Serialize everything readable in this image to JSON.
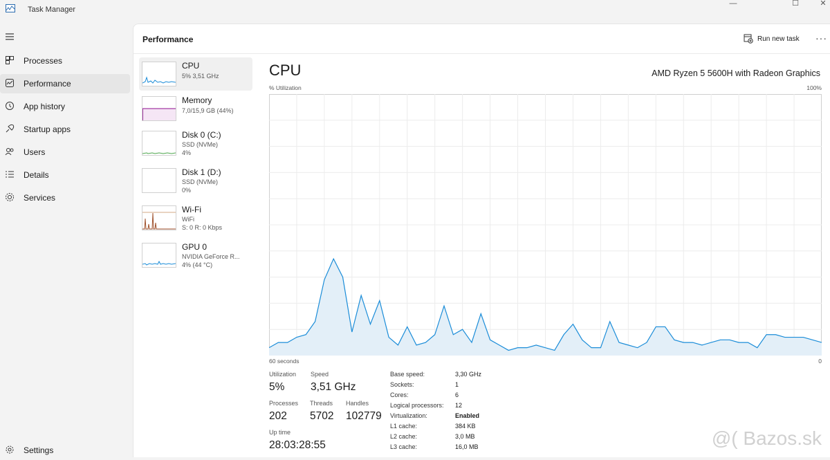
{
  "window": {
    "title": "Task Manager",
    "minimize": "—",
    "maximize": "☐",
    "close": "✕"
  },
  "nav": {
    "items": [
      {
        "label": "Processes",
        "icon": "processes-icon"
      },
      {
        "label": "Performance",
        "icon": "performance-icon",
        "active": true
      },
      {
        "label": "App history",
        "icon": "app-history-icon"
      },
      {
        "label": "Startup apps",
        "icon": "startup-apps-icon"
      },
      {
        "label": "Users",
        "icon": "users-icon"
      },
      {
        "label": "Details",
        "icon": "details-icon"
      },
      {
        "label": "Services",
        "icon": "services-icon"
      }
    ],
    "settings": "Settings"
  },
  "header": {
    "title": "Performance",
    "run_new_task": "Run new task",
    "more": "···"
  },
  "devices": [
    {
      "name": "CPU",
      "line1": "5%  3,51 GHz",
      "line2": ""
    },
    {
      "name": "Memory",
      "line1": "7,0/15,9 GB (44%)",
      "line2": ""
    },
    {
      "name": "Disk 0 (C:)",
      "line1": "SSD (NVMe)",
      "line2": "4%"
    },
    {
      "name": "Disk 1 (D:)",
      "line1": "SSD (NVMe)",
      "line2": "0%"
    },
    {
      "name": "Wi-Fi",
      "line1": "WiFi",
      "line2": "S: 0 R: 0 Kbps"
    },
    {
      "name": "GPU 0",
      "line1": "NVIDIA GeForce R...",
      "line2": "4% (44 °C)"
    }
  ],
  "detail": {
    "title": "CPU",
    "model": "AMD Ryzen 5 5600H with Radeon Graphics",
    "y_label": "% Utilization",
    "y_max_label": "100%",
    "x_start_label": "60 seconds",
    "x_end_label": "0"
  },
  "chart_data": {
    "type": "area",
    "title": "",
    "xlabel": "",
    "ylabel": "% Utilization",
    "xlim": [
      60,
      0
    ],
    "ylim": [
      0,
      100
    ],
    "grid": true,
    "color": "#1a8cd8",
    "fill": "#e3eff8",
    "x": [
      60,
      59,
      58,
      57,
      56,
      55,
      54,
      53,
      52,
      51,
      50,
      49,
      48,
      47,
      46,
      45,
      44,
      43,
      42,
      41,
      40,
      39,
      38,
      37,
      36,
      35,
      34,
      33,
      32,
      31,
      30,
      29,
      28,
      27,
      26,
      25,
      24,
      23,
      22,
      21,
      20,
      19,
      18,
      17,
      16,
      15,
      14,
      13,
      12,
      11,
      10,
      9,
      8,
      7,
      6,
      5,
      4,
      3,
      2,
      1,
      0
    ],
    "values": [
      3,
      5,
      5,
      7,
      8,
      13,
      29,
      37,
      30,
      9,
      23,
      12,
      21,
      7,
      4,
      11,
      4,
      5,
      8,
      19,
      8,
      10,
      5,
      16,
      6,
      4,
      2,
      3,
      3,
      4,
      3,
      2,
      8,
      12,
      6,
      3,
      3,
      13,
      5,
      4,
      3,
      5,
      11,
      11,
      6,
      5,
      5,
      4,
      5,
      6,
      6,
      5,
      5,
      3,
      8,
      8,
      7,
      7,
      7,
      6,
      5
    ]
  },
  "stats": {
    "utilization_label": "Utilization",
    "utilization": "5%",
    "speed_label": "Speed",
    "speed": "3,51 GHz",
    "processes_label": "Processes",
    "processes": "202",
    "threads_label": "Threads",
    "threads": "5702",
    "handles_label": "Handles",
    "handles": "102779",
    "uptime_label": "Up time",
    "uptime": "28:03:28:55"
  },
  "specs": [
    {
      "k": "Base speed:",
      "v": "3,30 GHz"
    },
    {
      "k": "Sockets:",
      "v": "1"
    },
    {
      "k": "Cores:",
      "v": "6"
    },
    {
      "k": "Logical processors:",
      "v": "12"
    },
    {
      "k": "Virtualization:",
      "v": "Enabled",
      "bold": true
    },
    {
      "k": "L1 cache:",
      "v": "384 KB"
    },
    {
      "k": "L2 cache:",
      "v": "3,0 MB"
    },
    {
      "k": "L3 cache:",
      "v": "16,0 MB"
    }
  ],
  "watermark": "@( Bazos.sk"
}
